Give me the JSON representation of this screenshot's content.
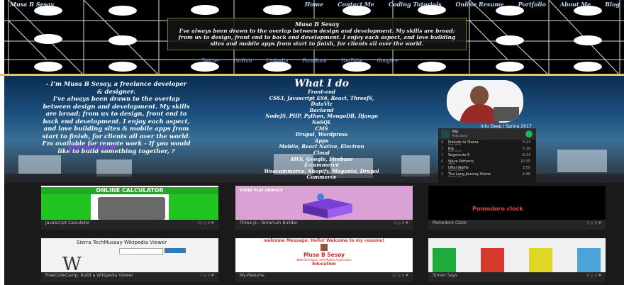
{
  "header": {
    "brand": "Musa B Sesay",
    "nav": [
      "Home",
      "Contact Me",
      "Coding Tutorials",
      "Online Resume",
      "Portfolio",
      "About Me",
      "Blog"
    ]
  },
  "intro": {
    "name": "Musa B Sesay",
    "text": "I've always been drawn to the overlap between design and development. My skills are broad; from ux to design, front end to back end development. I enjoy each aspect, and love building sites and mobile apps from start to finish, for clients all over the world."
  },
  "social": [
    "Twitter",
    "GitHub",
    "Linkedin",
    "FaceBook",
    "YouTube",
    "Google+"
  ],
  "about": {
    "lines": [
      "- I'm Musa B Sesay, a freelance developer",
      "& designer.",
      "I've always been drawn to the overlap",
      "between design and development. My skills",
      "are broad; from ux to design, front end to",
      "back end development. I enjoy each aspect,",
      "and love building sites & mobile apps from",
      "start to finish, for clients all over the world.",
      "I'm available for remote work - If you would",
      "like to build something together, ?"
    ],
    "cta": "get in touch"
  },
  "what_i_do": {
    "title": "What I do",
    "lines": [
      "Front-end",
      "CSS3, Javascript ES6, React, ThreeJS,",
      "DataViz",
      "Backend",
      "NodeJS, PHP, Python, MongoDB, Django",
      "NoSQL",
      "CMS",
      "Drupal, Wordpress",
      "Apps",
      "Mobile, React Native, Electron",
      "Cloud",
      "AWS, Google, Firebase",
      "E-commerce",
      "Woocommerce, Shopify, Magento, Drupal",
      "Commerce"
    ]
  },
  "photo_label": "Into Deep | Spring 2017",
  "spotify": {
    "title": "Ria",
    "artist": "Mike Vanis",
    "subtitle": "Sweet Tea Nas",
    "tracks": [
      {
        "n": "8",
        "title": "Prelude to Shona",
        "artist": "Mike Vanis",
        "dur": "3:23"
      },
      {
        "n": "3",
        "title": "Ria",
        "artist": "Mike Vanis",
        "dur": "5:30"
      },
      {
        "n": "1",
        "title": "Segmento 5",
        "artist": "",
        "dur": "6:14"
      },
      {
        "n": "6",
        "title": "Wave Patterns",
        "artist": "Other",
        "dur": "10:35"
      },
      {
        "n": "7",
        "title": "Offal Waffle",
        "artist": "Chris People",
        "dur": "3:55"
      },
      {
        "n": "5",
        "title": "The Long Journey Home",
        "artist": "Gavriel Zur",
        "dur": "4:48"
      }
    ]
  },
  "projects": [
    {
      "title": "JavaScript Calculator",
      "heading": "ONLINE CALCULATOR",
      "stats": "22 ◎ 0 ♥"
    },
    {
      "title": "Three.js - Terrarium Builder",
      "heading": "THREE PLAY ANIMATE",
      "stats": "0 ◎ 0 ♥"
    },
    {
      "title": "Pomodoro Clock",
      "heading": "Pomodoro clock",
      "stats": "0 ◎ 0 ♥"
    },
    {
      "title": "FreeCodeCamp: Build a Wikipedia Viewer",
      "heading": "Sierra TechMussay Wikipedia Viewer",
      "stats": "7 ◎ 0 ♥"
    },
    {
      "title": "My-Resume",
      "heading": "welcome Message: Hello! Welcome to my resume!",
      "name": "Musa B Sesay",
      "sub": "Web Developer and Mobile Application",
      "section": "Education",
      "stats": "21 ◎ 0 ♥"
    },
    {
      "title": "Simon Says",
      "heading": "",
      "stats": "0 ◎ 0 ♥"
    }
  ],
  "colors": {
    "simon": [
      "#1faa3c",
      "#d63a2c",
      "#e0d628",
      "#4ba3d8"
    ]
  }
}
